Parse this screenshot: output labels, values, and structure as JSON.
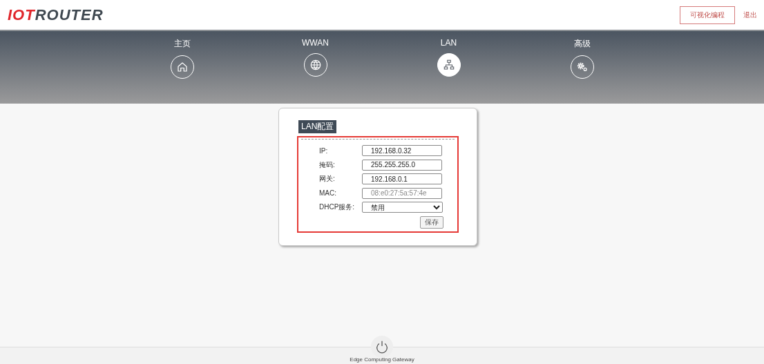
{
  "header": {
    "logo": {
      "accent": "IOT",
      "rest": "ROUTER"
    },
    "buttons": [
      {
        "label": "可视化编程",
        "kind": "outlined"
      },
      {
        "label": "退出",
        "kind": "link"
      }
    ]
  },
  "nav": {
    "tabs": [
      {
        "label": "主页",
        "kind": "home",
        "selected": false
      },
      {
        "label": "WWAN",
        "kind": "globe",
        "selected": false
      },
      {
        "label": "LAN",
        "kind": "network",
        "selected": true
      },
      {
        "label": "高级",
        "kind": "gears",
        "selected": false
      }
    ]
  },
  "panel": {
    "title": "LAN配置",
    "fields": [
      {
        "label": "IP:",
        "value": "192.168.0.32",
        "kind": "text",
        "disabled": false
      },
      {
        "label": "掩码:",
        "value": "255.255.255.0",
        "kind": "text",
        "disabled": false
      },
      {
        "label": "网关:",
        "value": "192.168.0.1",
        "kind": "text",
        "disabled": false
      },
      {
        "label": "MAC:",
        "value": "08:e0:27:5a:57:4e",
        "kind": "text",
        "disabled": true
      },
      {
        "label": "DHCP服务:",
        "value": "禁用",
        "kind": "select",
        "disabled": false
      }
    ],
    "save": "保存"
  },
  "footer": {
    "text": "Edge Computing Gateway"
  }
}
